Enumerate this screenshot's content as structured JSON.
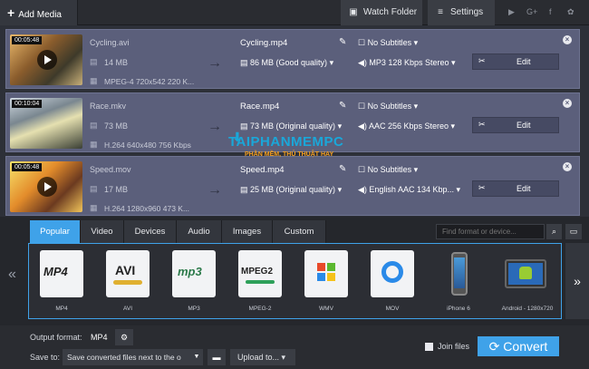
{
  "toolbar": {
    "add_media": "Add Media",
    "watch_folder": "Watch Folder",
    "settings": "Settings",
    "social_icons": [
      "youtube-icon",
      "google-plus-icon",
      "facebook-icon",
      "vk-icon"
    ]
  },
  "files": [
    {
      "duration": "00:05:48",
      "name": "Cycling.avi",
      "size": "14 MB",
      "meta": "MPEG-4 720x542 220 K...",
      "output_name": "Cycling.mp4",
      "output_size": "86 MB (Good quality)",
      "subtitles": "No Subtitles",
      "audio": "MP3 128 Kbps Stereo",
      "edit": "Edit"
    },
    {
      "duration": "00:10:04",
      "name": "Race.mkv",
      "size": "73 MB",
      "meta": "H.264 640x480 756 Kbps",
      "output_name": "Race.mp4",
      "output_size": "73 MB (Original quality)",
      "subtitles": "No Subtitles",
      "audio": "AAC 256 Kbps Stereo",
      "edit": "Edit"
    },
    {
      "duration": "00:05:48",
      "name": "Speed.mov",
      "size": "17 MB",
      "meta": "H.264 1280x960 473 K...",
      "output_name": "Speed.mp4",
      "output_size": "25 MB (Original quality)",
      "subtitles": "No Subtitles",
      "audio": "English AAC 134 Kbp...",
      "edit": "Edit"
    }
  ],
  "watermark": {
    "title": "TAIPHANMEMPC",
    "subtitle": "PHẦN MỀM, THỦ THUẬT HAY"
  },
  "format_tabs": [
    "Popular",
    "Video",
    "Devices",
    "Audio",
    "Images",
    "Custom"
  ],
  "format_search_placeholder": "Find format or device...",
  "formats": [
    {
      "label": "MP4",
      "badge": "MP4"
    },
    {
      "label": "AVI",
      "badge": "AVI"
    },
    {
      "label": "MP3",
      "badge": "mp3"
    },
    {
      "label": "MPEG-2",
      "badge": "MPEG2"
    },
    {
      "label": "WMV",
      "badge": ""
    },
    {
      "label": "MOV",
      "badge": ""
    },
    {
      "label": "iPhone 6",
      "badge": ""
    },
    {
      "label": "Android - 1280x720",
      "badge": ""
    }
  ],
  "bottom": {
    "output_format_label": "Output format:",
    "output_format_value": "MP4",
    "save_to_label": "Save to:",
    "save_to_value": "Save converted files next to the o",
    "upload": "Upload to...",
    "join_files": "Join files",
    "convert": "Convert"
  },
  "colors": {
    "accent": "#3fa2e9",
    "row_bg": "#5b5f7b",
    "app_bg": "#2c2f36"
  }
}
